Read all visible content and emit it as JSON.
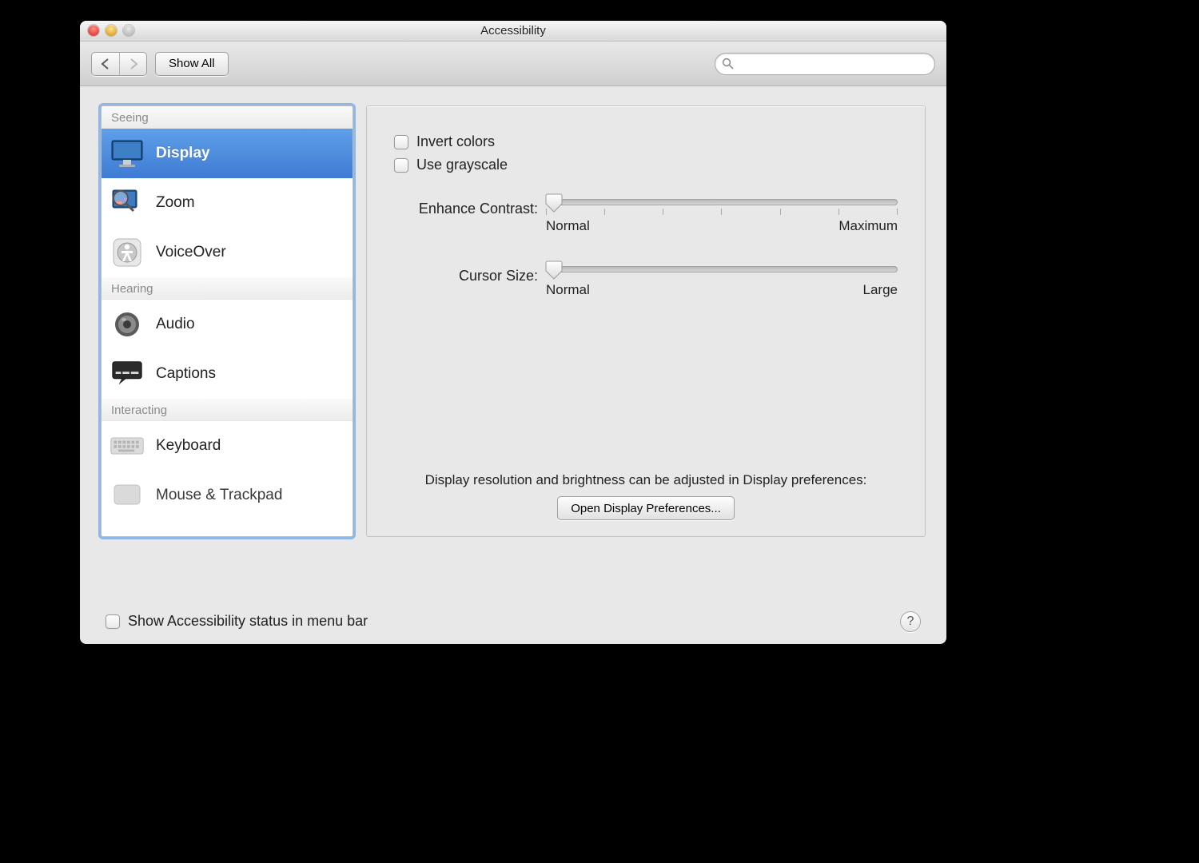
{
  "window": {
    "title": "Accessibility"
  },
  "toolbar": {
    "show_all_label": "Show All",
    "search_placeholder": ""
  },
  "sidebar": {
    "categories": [
      {
        "header": "Seeing",
        "items": [
          {
            "key": "display",
            "label": "Display",
            "selected": true
          },
          {
            "key": "zoom",
            "label": "Zoom",
            "selected": false
          },
          {
            "key": "voiceover",
            "label": "VoiceOver",
            "selected": false
          }
        ]
      },
      {
        "header": "Hearing",
        "items": [
          {
            "key": "audio",
            "label": "Audio",
            "selected": false
          },
          {
            "key": "captions",
            "label": "Captions",
            "selected": false
          }
        ]
      },
      {
        "header": "Interacting",
        "items": [
          {
            "key": "keyboard",
            "label": "Keyboard",
            "selected": false
          },
          {
            "key": "mouse-trackpad",
            "label": "Mouse & Trackpad",
            "selected": false
          }
        ]
      }
    ]
  },
  "main": {
    "invert_colors_label": "Invert colors",
    "invert_colors_checked": false,
    "use_grayscale_label": "Use grayscale",
    "use_grayscale_checked": false,
    "enhance_contrast": {
      "label": "Enhance Contrast:",
      "min_label": "Normal",
      "max_label": "Maximum",
      "ticks": 7,
      "value_pct": 0
    },
    "cursor_size": {
      "label": "Cursor Size:",
      "min_label": "Normal",
      "max_label": "Large",
      "ticks": 0,
      "value_pct": 0
    },
    "footer_hint": "Display resolution and brightness can be adjusted in Display preferences:",
    "open_display_prefs_label": "Open Display Preferences..."
  },
  "bottom": {
    "show_status_label": "Show Accessibility status in menu bar",
    "show_status_checked": false
  }
}
